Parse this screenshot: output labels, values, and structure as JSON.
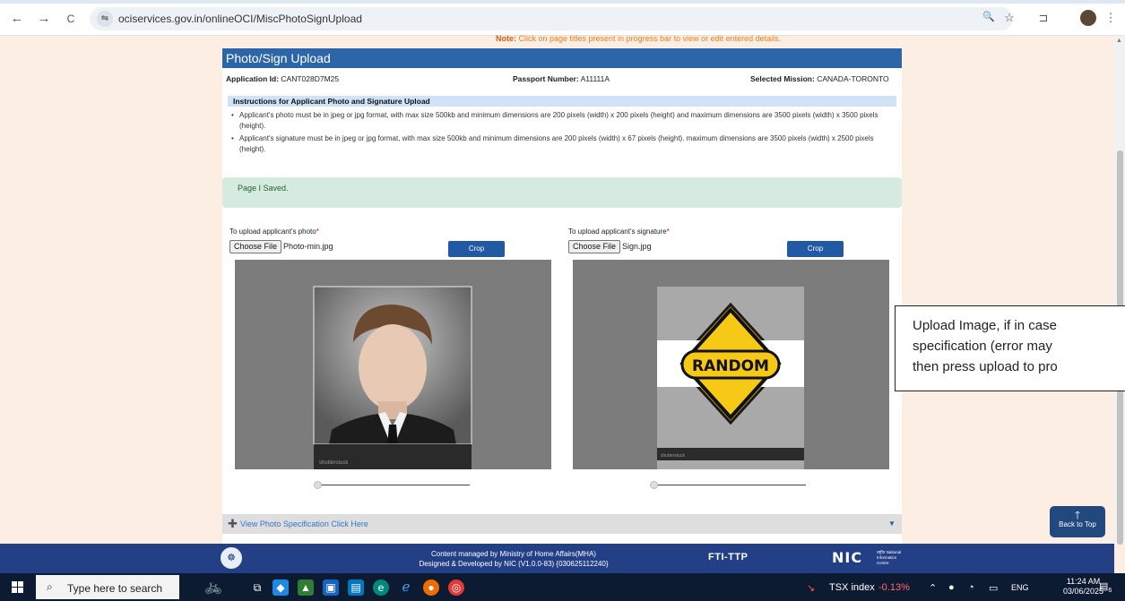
{
  "browser": {
    "url": "ociservices.gov.in/onlineOCI/MiscPhotoSignUpload",
    "back_icon": "←",
    "forward_icon": "→",
    "reload_icon": "C",
    "site_info_icon": "⇋",
    "zoom_icon": "🔍",
    "bookmark_icon": "☆",
    "extensions_icon": "⊐",
    "menu_icon": "⋮"
  },
  "page": {
    "note_label": "Note:",
    "note_text": " Click on page titles present in progress bar to view or edit entered details.",
    "card_title": "Photo/Sign Upload",
    "application_id_label": "Application Id:",
    "application_id": "CANT028D7M25",
    "passport_label": "Passport Number:",
    "passport_number": "A11111A",
    "mission_label": "Selected Mission:",
    "mission": "CANADA-TORONTO",
    "instructions_heading": "Instructions for Applicant Photo and Signature Upload",
    "instructions": [
      "Applicant's photo must be in jpeg or jpg format, with max size 500kb and minimum dimensions are 200 pixels (width) x 200 pixels (height) and maximum dimensions are 3500 pixels (width) x 3500 pixels (height).",
      "Applicant's signature must be in jpeg or jpg format, with max size 500kb and minimum dimensions are 200 pixels (width) x 67 pixels (height). maximum dimensions are 3500 pixels (width) x 2500 pixels (height)."
    ],
    "saved_message": "Page I Saved.",
    "photo": {
      "label": "To upload applicant's photo",
      "required_mark": "*",
      "choose_file_label": "Choose File",
      "file_name": "Photo-min.jpg",
      "crop_label": "Crop",
      "watermark": "shutterstuck"
    },
    "signature": {
      "label": "To upload applicant's signature",
      "required_mark": "*",
      "choose_file_label": "Choose File",
      "file_name": "Sign.jpg",
      "crop_label": "Crop",
      "sign_text": "RANDOM",
      "watermark": "shutterstuck"
    },
    "spec_link": "View Photo Specification Click Here",
    "plus_icon": "✚",
    "chevron_icon": "▼",
    "back_to_top_label": "Back to Top",
    "back_to_top_icon": "🡑",
    "callout_lines": [
      "Upload Image, if in case",
      "specification (error may",
      "then press upload to pro"
    ]
  },
  "footer": {
    "line1": "Content managed by Ministry of Home Affairs(MHA)",
    "line2": "Designed & Developed by NIC (V1.0.0-83) {030625112240}",
    "ftitp": "FTI-TTP",
    "nic": "NIC",
    "nic_subtitle": "राष्ट्रीय National Informatics Centre"
  },
  "taskbar": {
    "search_placeholder": "Type here to search",
    "ticker_name": "TSX index",
    "ticker_change": "-0.13%",
    "language": "ENG",
    "time": "11:24 AM",
    "date": "03/06/2025",
    "notification_count": "6"
  }
}
